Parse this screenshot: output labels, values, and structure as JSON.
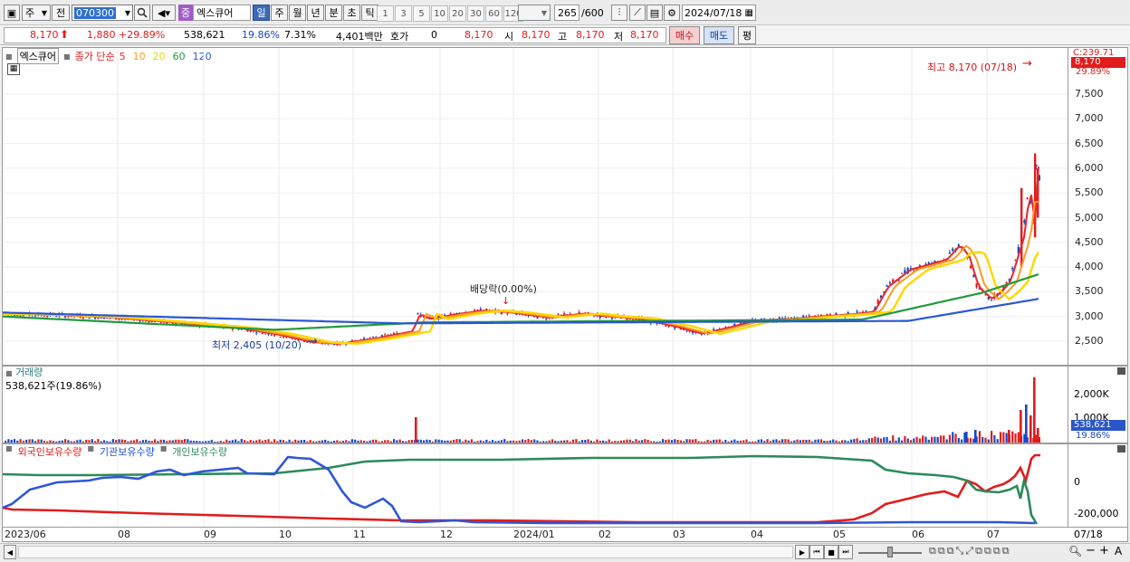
{
  "toolbar": {
    "market": "주",
    "prefix": "전",
    "code": "070300",
    "sector_badge": "중",
    "stock_name": "엑스큐어",
    "periods": [
      "일",
      "주",
      "월",
      "년",
      "분",
      "초",
      "틱"
    ],
    "active_period": "일",
    "numbers": [
      "1",
      "3",
      "5",
      "10",
      "20",
      "30",
      "60",
      "120"
    ],
    "count": "265",
    "count_total": "/600",
    "date": "2024/07/18"
  },
  "quote": {
    "price": "8,170",
    "change": "1,880",
    "change_pct": "+29.89%",
    "volume": "538,621",
    "vol_ratio": "19.86%",
    "turnover": "7.31%",
    "amount": "4,401백만",
    "hoga_label": "호가",
    "hoga_value": "0",
    "current": "8,170",
    "open_label": "시",
    "open": "8,170",
    "high_label": "고",
    "high": "8,170",
    "low_label": "저",
    "low": "8,170",
    "buy_button": "매수",
    "sell_button": "매도",
    "eval_button": "평"
  },
  "price_panel": {
    "name": "엑스큐어",
    "legend_prefix": "종가 단순",
    "ma": [
      {
        "label": "5",
        "color": "#e8242a"
      },
      {
        "label": "10",
        "color": "#ff9a1e"
      },
      {
        "label": "20",
        "color": "#e8d400"
      },
      {
        "label": "60",
        "color": "#219a3c"
      },
      {
        "label": "120",
        "color": "#2a56d8"
      }
    ],
    "high_note": "최고 8,170 (07/18)",
    "low_note": "최저 2,405 (10/20)",
    "dividend_note": "배당락(0.00%)",
    "y_ticks": [
      "7,500",
      "7,000",
      "6,500",
      "6,000",
      "5,500",
      "5,000",
      "4,500",
      "4,000",
      "3,500",
      "3,000",
      "2,500"
    ],
    "top_label": "C:239.71",
    "price_badge": "8,170",
    "pct_label": "29.89%"
  },
  "volume_panel": {
    "title": "거래량",
    "value": "538,621주(19.86%)",
    "y_ticks": [
      "2,000K",
      "1,000K"
    ],
    "badge": "538,621",
    "pct": "19.86%"
  },
  "holding_panel": {
    "legends": [
      {
        "label": "외국인보유수량",
        "color": "#e21c1c"
      },
      {
        "label": "기관보유수량",
        "color": "#1f4fd8"
      },
      {
        "label": "개인보유수량",
        "color": "#2b8a5a"
      }
    ],
    "y_ticks": [
      "0",
      "-200,000"
    ]
  },
  "x_axis": [
    "2023/06",
    "08",
    "09",
    "10",
    "11",
    "12",
    "2024/01",
    "02",
    "03",
    "04",
    "05",
    "06",
    "07"
  ],
  "x_axis_end": "07/18",
  "colors": {
    "up": "#e21c1c",
    "down": "#1548c8",
    "accent": "#3b6ab8"
  },
  "icons": [
    "search-icon",
    "sound-icon",
    "candle-chart-icon",
    "crosshair-icon",
    "save-icon",
    "gear-icon",
    "calendar-icon",
    "play-icon",
    "rewind-icon",
    "stop-icon",
    "fast-forward-icon",
    "zoom-out-icon",
    "zoom-in-icon"
  ]
}
